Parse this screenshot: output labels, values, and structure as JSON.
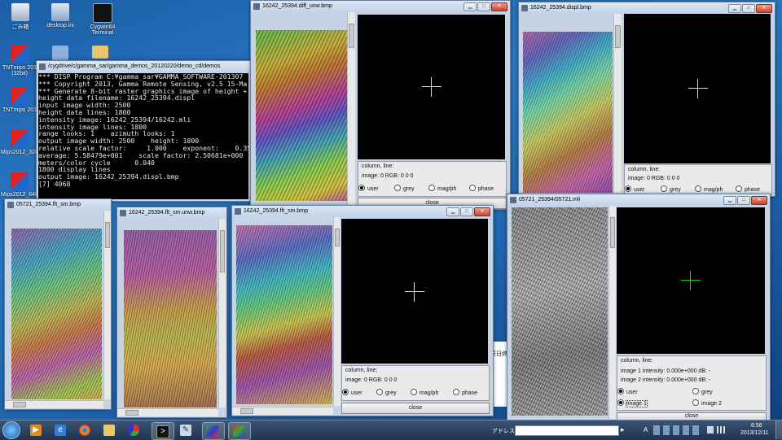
{
  "desktop": {
    "icons": [
      {
        "label": "ごみ箱"
      },
      {
        "label": "desktop.ini"
      },
      {
        "label": "Cygwin64 Terminal"
      },
      {
        "label": "TNTmips 201 (32bit)"
      },
      {
        "label": "TNTmips 201"
      },
      {
        "label": "Mips2012_32b"
      },
      {
        "label": "Mips2012_64b"
      }
    ]
  },
  "terminal": {
    "title": "/cygdrive/c/gamma_sar/gamma_demos_20120220/demo_cd/demos",
    "lines": [
      "*** DISP Program C:¥gamma_sar¥GAMMA_SOFTWARE-201307",
      "*** Copyright 2013, Gamma Remote Sensing, v2.5 15-Ma",
      "*** Generate 8-bit raster graphics image of height +",
      "height data filename: 16242_25394.displ",
      "input image width: 2500",
      "height data lines: 1800",
      "intensity image: 16242_25394/16242.mli",
      "intensity image lines: 1800",
      "range looks: 1    azimuth looks: 1",
      "output image width: 2500    height: 1800",
      "relative scale factor:     1.000    exponent:    0.350",
      "average: 5.58479e+001    scale factor: 2.50681e+000",
      "meters/color cycle      0.040",
      "1800 display lines",
      "output image: 16242_25394.displ.bmp",
      "[7] 4068"
    ]
  },
  "windows": {
    "diff_unw": {
      "title": "16242_25394.diff_unw.bmp",
      "coord_label": "column, line:",
      "image_readout": "image:  0   RGB:   0   0   0",
      "radios": [
        "user",
        "grey",
        "mag/ph",
        "phase"
      ],
      "selected": "user",
      "close_label": "close"
    },
    "displ": {
      "title": "16242_25394.displ.bmp",
      "coord_label": "column, line:",
      "image_readout": "image:  0   RGB:   0   0   0",
      "radios": [
        "user",
        "grey",
        "mag/ph",
        "phase"
      ],
      "selected": "user"
    },
    "flt_sm_1": {
      "title": "05721_25394.flt_sm.bmp"
    },
    "flt_sm_unw": {
      "title": "16242_25394.flt_sm.unw.bmp"
    },
    "flt_sm_2": {
      "title": "16242_25394.flt_sm.bmp",
      "coord_label": "column, line:",
      "image_readout": "image:  0   RGB:   0   0   0",
      "radios": [
        "user",
        "grey",
        "mag/ph",
        "phase"
      ],
      "selected": "user",
      "close_label": "close"
    },
    "mli": {
      "title": "05721_25394/05721.mli",
      "coord_label": "column, line:",
      "intensity1": "image 1 intensity:  0.000e+000  dB:    -",
      "intensity2": "image 2 intensity:  0.000e+000  dB:    -",
      "radios_top": [
        "user",
        "grey"
      ],
      "radios_bottom": [
        "image 1",
        "image 2"
      ],
      "selected_top": "user",
      "selected_bottom": "image 1",
      "close_label": "close"
    }
  },
  "background_window": {
    "fragment": "更日終"
  },
  "taskbar": {
    "address_label": "アドレス",
    "time": "6:56",
    "date": "2013/12/11",
    "ime_label": "A"
  }
}
